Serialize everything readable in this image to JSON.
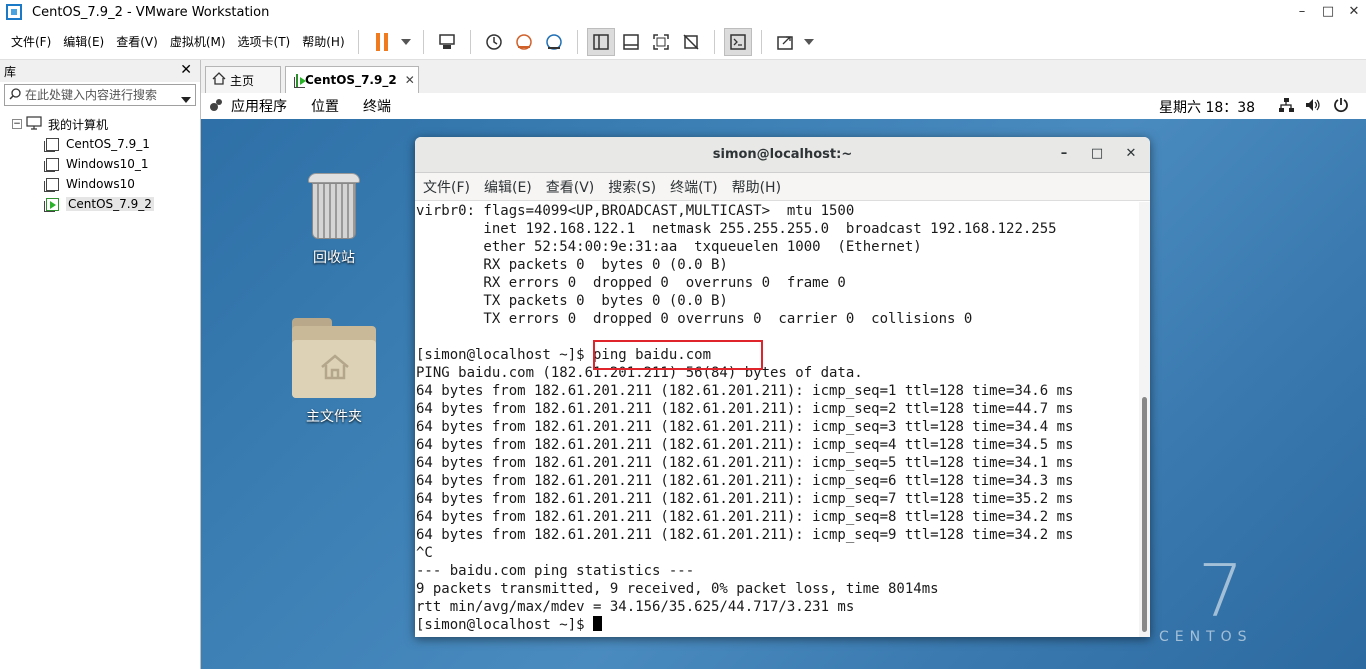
{
  "window": {
    "title": "CentOS_7.9_2 - VMware Workstation",
    "minimize": "–",
    "maximize": "□",
    "close": "✕"
  },
  "menubar": {
    "items": [
      "文件(F)",
      "编辑(E)",
      "查看(V)",
      "虚拟机(M)",
      "选项卡(T)",
      "帮助(H)"
    ]
  },
  "toolbar": {
    "pause_color": "#f07a1e",
    "icons": [
      "pause-icon",
      "dropdown-icon",
      "send-ctrl-alt-del-icon",
      "snapshot-icon",
      "revert-snapshot-icon",
      "snapshot-manager-icon",
      "library-view-icon",
      "thumbnail-view-icon",
      "fullscreen-icon",
      "unity-icon",
      "console-view-icon",
      "stretch-icon"
    ]
  },
  "library": {
    "title": "库",
    "close": "✕",
    "search_placeholder": "在此处键入内容进行搜索",
    "root_label": "我的计算机",
    "items": [
      {
        "label": "CentOS_7.9_1",
        "running": false
      },
      {
        "label": "Windows10_1",
        "running": false
      },
      {
        "label": "Windows10",
        "running": false
      },
      {
        "label": "CentOS_7.9_2",
        "running": true,
        "selected": true
      }
    ]
  },
  "tabs": [
    {
      "label": "主页",
      "icon": "home-icon",
      "active": false
    },
    {
      "label": "CentOS_7.9_2",
      "icon": "vm-running-icon",
      "active": true,
      "close": "✕"
    }
  ],
  "gnome": {
    "menus": [
      "应用程序",
      "位置",
      "终端"
    ],
    "clock": "星期六 18：38"
  },
  "desktop": {
    "trash_label": "回收站",
    "home_label": "主文件夹",
    "brand_number": "7",
    "brand_word": "CENTOS"
  },
  "terminal": {
    "title": "simon@localhost:~",
    "minimize": "–",
    "maximize": "□",
    "close": "✕",
    "menus": [
      "文件(F)",
      "编辑(E)",
      "查看(V)",
      "搜索(S)",
      "终端(T)",
      "帮助(H)"
    ],
    "highlight_color": "#e0242b",
    "lines": [
      "virbr0: flags=4099<UP,BROADCAST,MULTICAST>  mtu 1500",
      "        inet 192.168.122.1  netmask 255.255.255.0  broadcast 192.168.122.255",
      "        ether 52:54:00:9e:31:aa  txqueuelen 1000  (Ethernet)",
      "        RX packets 0  bytes 0 (0.0 B)",
      "        RX errors 0  dropped 0  overruns 0  frame 0",
      "        TX packets 0  bytes 0 (0.0 B)",
      "        TX errors 0  dropped 0 overruns 0  carrier 0  collisions 0",
      "",
      "[simon@localhost ~]$ ping baidu.com",
      "PING baidu.com (182.61.201.211) 56(84) bytes of data.",
      "64 bytes from 182.61.201.211 (182.61.201.211): icmp_seq=1 ttl=128 time=34.6 ms",
      "64 bytes from 182.61.201.211 (182.61.201.211): icmp_seq=2 ttl=128 time=44.7 ms",
      "64 bytes from 182.61.201.211 (182.61.201.211): icmp_seq=3 ttl=128 time=34.4 ms",
      "64 bytes from 182.61.201.211 (182.61.201.211): icmp_seq=4 ttl=128 time=34.5 ms",
      "64 bytes from 182.61.201.211 (182.61.201.211): icmp_seq=5 ttl=128 time=34.1 ms",
      "64 bytes from 182.61.201.211 (182.61.201.211): icmp_seq=6 ttl=128 time=34.3 ms",
      "64 bytes from 182.61.201.211 (182.61.201.211): icmp_seq=7 ttl=128 time=35.2 ms",
      "64 bytes from 182.61.201.211 (182.61.201.211): icmp_seq=8 ttl=128 time=34.2 ms",
      "64 bytes from 182.61.201.211 (182.61.201.211): icmp_seq=9 ttl=128 time=34.2 ms",
      "^C",
      "--- baidu.com ping statistics ---",
      "9 packets transmitted, 9 received, 0% packet loss, time 8014ms",
      "rtt min/avg/max/mdev = 34.156/35.625/44.717/3.231 ms"
    ],
    "prompt": "[simon@localhost ~]$ "
  }
}
